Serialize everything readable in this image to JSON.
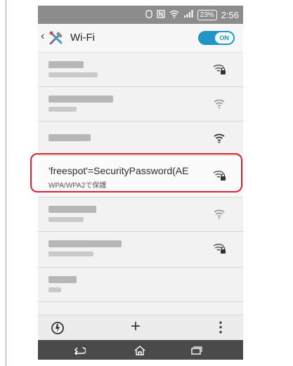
{
  "status_bar": {
    "battery": "23%",
    "time": "2:56"
  },
  "header": {
    "title": "Wi-Fi",
    "toggle_label": "ON"
  },
  "networks": [
    {
      "secured": true
    },
    {
      "secured": false
    },
    {
      "secured": false
    },
    {
      "ssid": "'freespot'=SecurityPassword(AE",
      "security": "WPA/WPA2で保護",
      "secured": true,
      "highlighted": true
    },
    {
      "secured": false
    },
    {
      "secured": true
    },
    {
      "secured": false
    }
  ],
  "bottom_bar": {
    "add_label": "+",
    "more_label": "⋮"
  },
  "colors": {
    "status_bar": "#8c8c8c",
    "toggle_on": "#1f96c6",
    "highlight_border": "#d92231",
    "nav_bar": "#4a4a4a"
  }
}
